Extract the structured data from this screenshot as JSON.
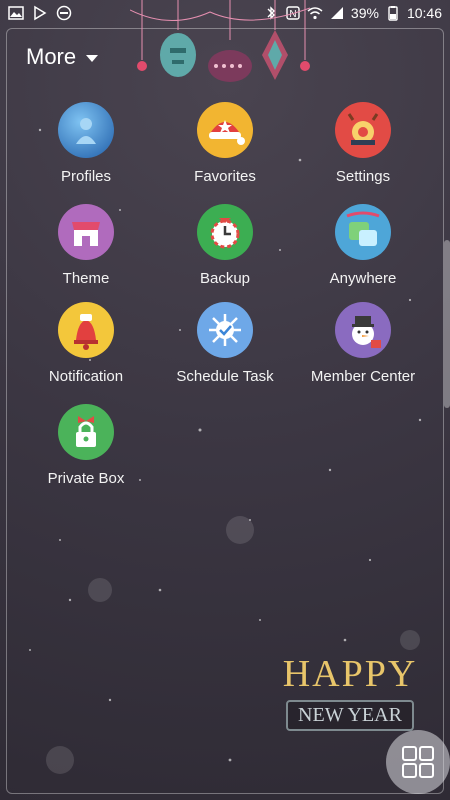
{
  "status_bar": {
    "battery": "39%",
    "time": "10:46",
    "icons_left": [
      "gallery-icon",
      "play-store-icon",
      "dnd-icon"
    ],
    "icons_right": [
      "bluetooth-icon",
      "nfc-icon",
      "wifi-icon",
      "signal-icon",
      "battery-icon"
    ]
  },
  "header": {
    "title": "More"
  },
  "apps": [
    {
      "label": "Profiles",
      "icon": "profiles-icon",
      "color": "#2f78c4"
    },
    {
      "label": "Favorites",
      "icon": "favorites-icon",
      "color": "#f2b531"
    },
    {
      "label": "Settings",
      "icon": "settings-icon",
      "color": "#e24b45"
    },
    {
      "label": "Theme",
      "icon": "theme-icon",
      "color": "#b06bbd"
    },
    {
      "label": "Backup",
      "icon": "backup-icon",
      "color": "#3cae52"
    },
    {
      "label": "Anywhere",
      "icon": "anywhere-icon",
      "color": "#4ea6d8"
    },
    {
      "label": "Notification",
      "icon": "notification-icon",
      "color": "#f3c73b"
    },
    {
      "label": "Schedule Task",
      "icon": "schedule-task-icon",
      "color": "#6ea8e8"
    },
    {
      "label": "Member Center",
      "icon": "member-center-icon",
      "color": "#8a6bc0"
    },
    {
      "label": "Private Box",
      "icon": "private-box-icon",
      "color": "#4bb35a"
    }
  ],
  "banner": {
    "line1": "HAPPY",
    "line2": "NEW YEAR"
  },
  "accent_color": "#e8c56a"
}
